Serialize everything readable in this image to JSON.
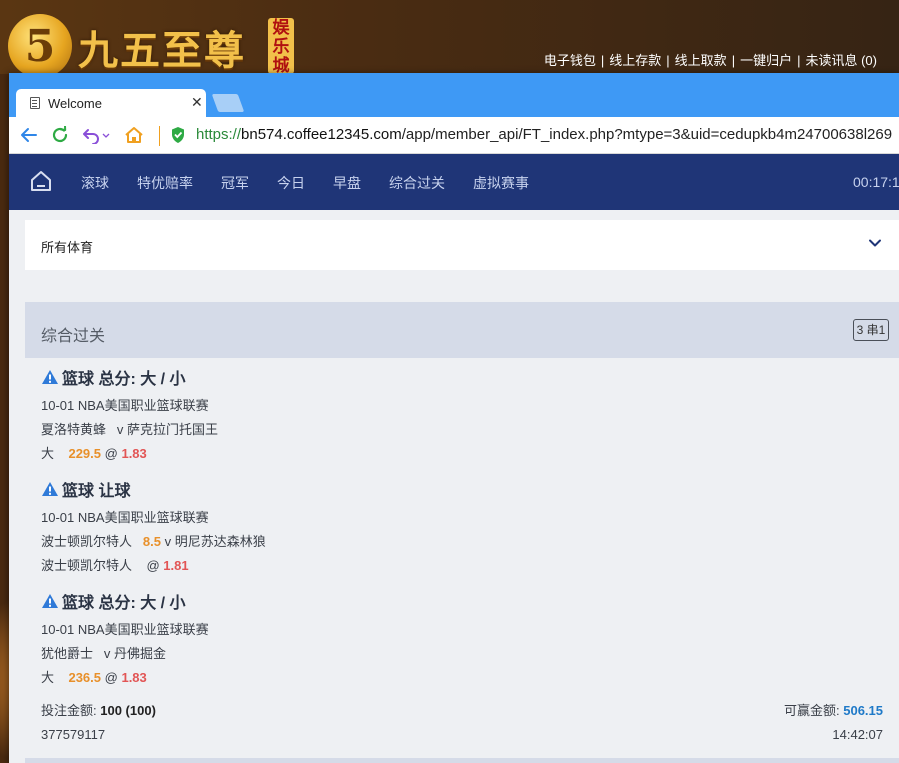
{
  "site": {
    "logo_char": "5",
    "logo_text": "九五至尊",
    "logo_tag": "娱乐城",
    "links": [
      "电子钱包",
      "线上存款",
      "线上取款",
      "一键归户",
      "未读讯息 (0)"
    ]
  },
  "browser": {
    "tab_title": "Welcome",
    "url_scheme": "https://",
    "url_host": "bn574.coffee12345.com",
    "url_path": "/app/member_api/FT_index.php?mtype=3&uid=cedupkb4m24700638l269"
  },
  "nav": {
    "items": [
      "滚球",
      "特优赔率",
      "冠军",
      "今日",
      "早盘",
      "综合过关",
      "虚拟赛事"
    ],
    "time": "00:17:1"
  },
  "sport_select": {
    "label": "所有体育"
  },
  "parlay": {
    "title": "综合过关",
    "badge": "3 串1",
    "bets": [
      {
        "market": "篮球 总分: 大 / 小",
        "league": "10-01 NBA美国职业篮球联赛",
        "home": "夏洛特黄蜂",
        "vs": "v",
        "away": "萨克拉门托国王",
        "pick": "大",
        "line": "229.5",
        "at": "@",
        "odds": "1.83"
      },
      {
        "market": "篮球 让球",
        "league": "10-01 NBA美国职业篮球联赛",
        "home": "波士顿凯尔特人",
        "handicap": "8.5",
        "vs": "v",
        "away": "明尼苏达森林狼",
        "pick": "波士顿凯尔特人",
        "at": "@",
        "odds": "1.81"
      },
      {
        "market": "篮球 总分: 大 / 小",
        "league": "10-01 NBA美国职业篮球联赛",
        "home": "犹他爵士",
        "vs": "v",
        "away": "丹佛掘金",
        "pick": "大",
        "line": "236.5",
        "at": "@",
        "odds": "1.83"
      }
    ],
    "stake_label": "投注金额:",
    "stake_value": "100 (100)",
    "win_label": "可赢金额:",
    "win_value": "506.15",
    "ticket_id": "377579117",
    "ticket_time": "14:42:07"
  },
  "colors": {
    "tab_bar": "#3e99f5",
    "navbar": "#1f3577",
    "orange": "#e8902a",
    "red": "#e25555",
    "blue": "#1f7ac8"
  }
}
